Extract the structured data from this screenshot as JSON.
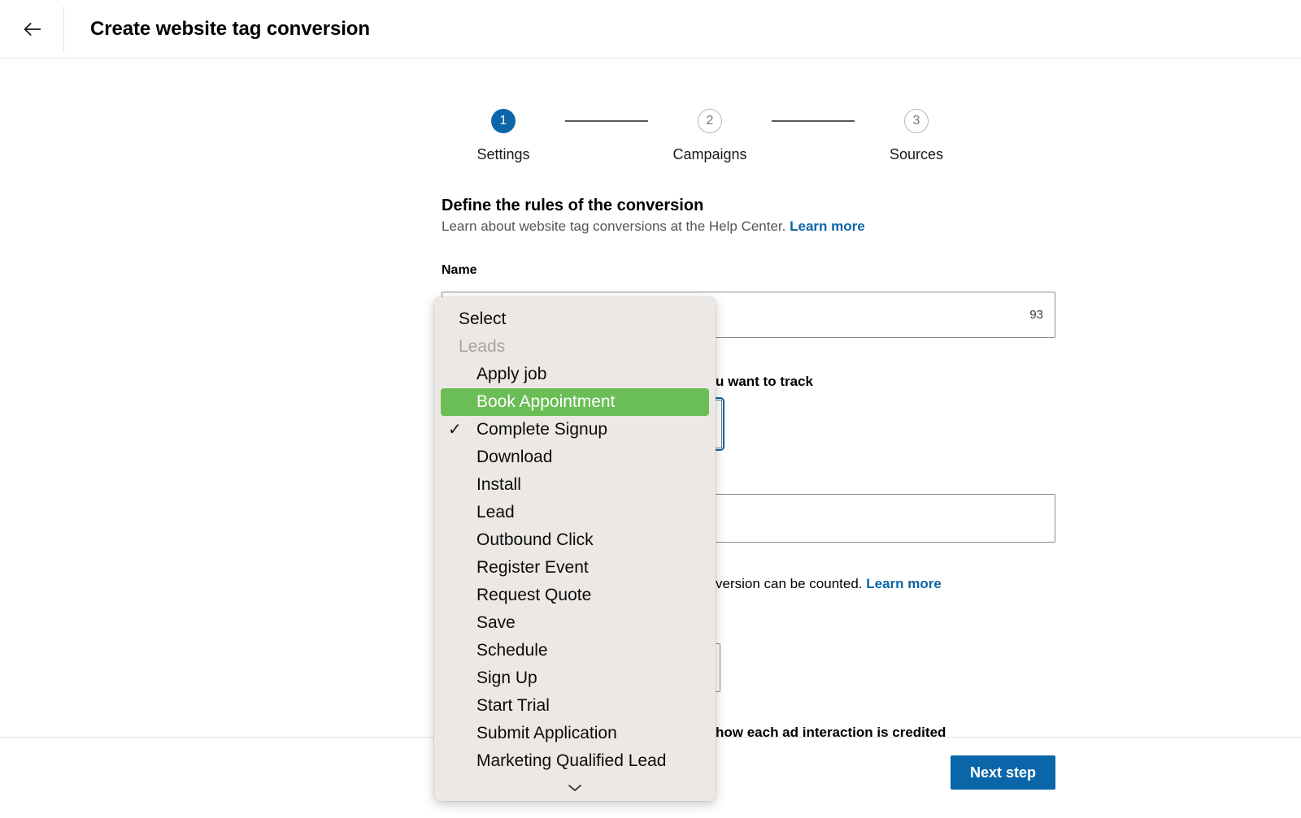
{
  "topbar": {
    "back_icon": "arrow-left-icon",
    "title": "Create website tag conversion"
  },
  "stepper": {
    "steps": [
      {
        "number": "1",
        "label": "Settings",
        "state": "active"
      },
      {
        "number": "2",
        "label": "Campaigns",
        "state": "idle"
      },
      {
        "number": "3",
        "label": "Sources",
        "state": "idle"
      }
    ]
  },
  "section": {
    "title": "Define the rules of the conversion",
    "subtitle": "Learn about website tag conversions at the Help Center.",
    "subtitle_link": "Learn more"
  },
  "form": {
    "name_label": "Name",
    "name_value": "",
    "name_char_count": "93",
    "action_helper_partial": "u want to track",
    "count_helper_partial": "version can be counted.",
    "count_helper_link": "Learn more",
    "attribution_helper_partial": "how each ad interaction is credited"
  },
  "footer": {
    "next_label": "Next step"
  },
  "dropdown": {
    "title": "Select",
    "group_label": "Leads",
    "selected_item": "Complete Signup",
    "highlighted_item": "Book Appointment",
    "check_glyph": "✓",
    "scroll_icon": "chevron-down-icon",
    "items": [
      {
        "label": "Apply job",
        "state": "normal"
      },
      {
        "label": "Book Appointment",
        "state": "highlight"
      },
      {
        "label": "Complete Signup",
        "state": "selected"
      },
      {
        "label": "Download",
        "state": "normal"
      },
      {
        "label": "Install",
        "state": "normal"
      },
      {
        "label": "Lead",
        "state": "normal"
      },
      {
        "label": "Outbound Click",
        "state": "normal"
      },
      {
        "label": "Register Event",
        "state": "normal"
      },
      {
        "label": "Request Quote",
        "state": "normal"
      },
      {
        "label": "Save",
        "state": "normal"
      },
      {
        "label": "Schedule",
        "state": "normal"
      },
      {
        "label": "Sign Up",
        "state": "normal"
      },
      {
        "label": "Start Trial",
        "state": "normal"
      },
      {
        "label": "Submit Application",
        "state": "normal"
      },
      {
        "label": "Marketing Qualified Lead",
        "state": "normal"
      }
    ]
  },
  "colors": {
    "accent_blue": "#0a66a8",
    "link_blue": "#0b66a5",
    "highlight_green": "#6bbd56",
    "menu_bg": "#ece8e5"
  }
}
